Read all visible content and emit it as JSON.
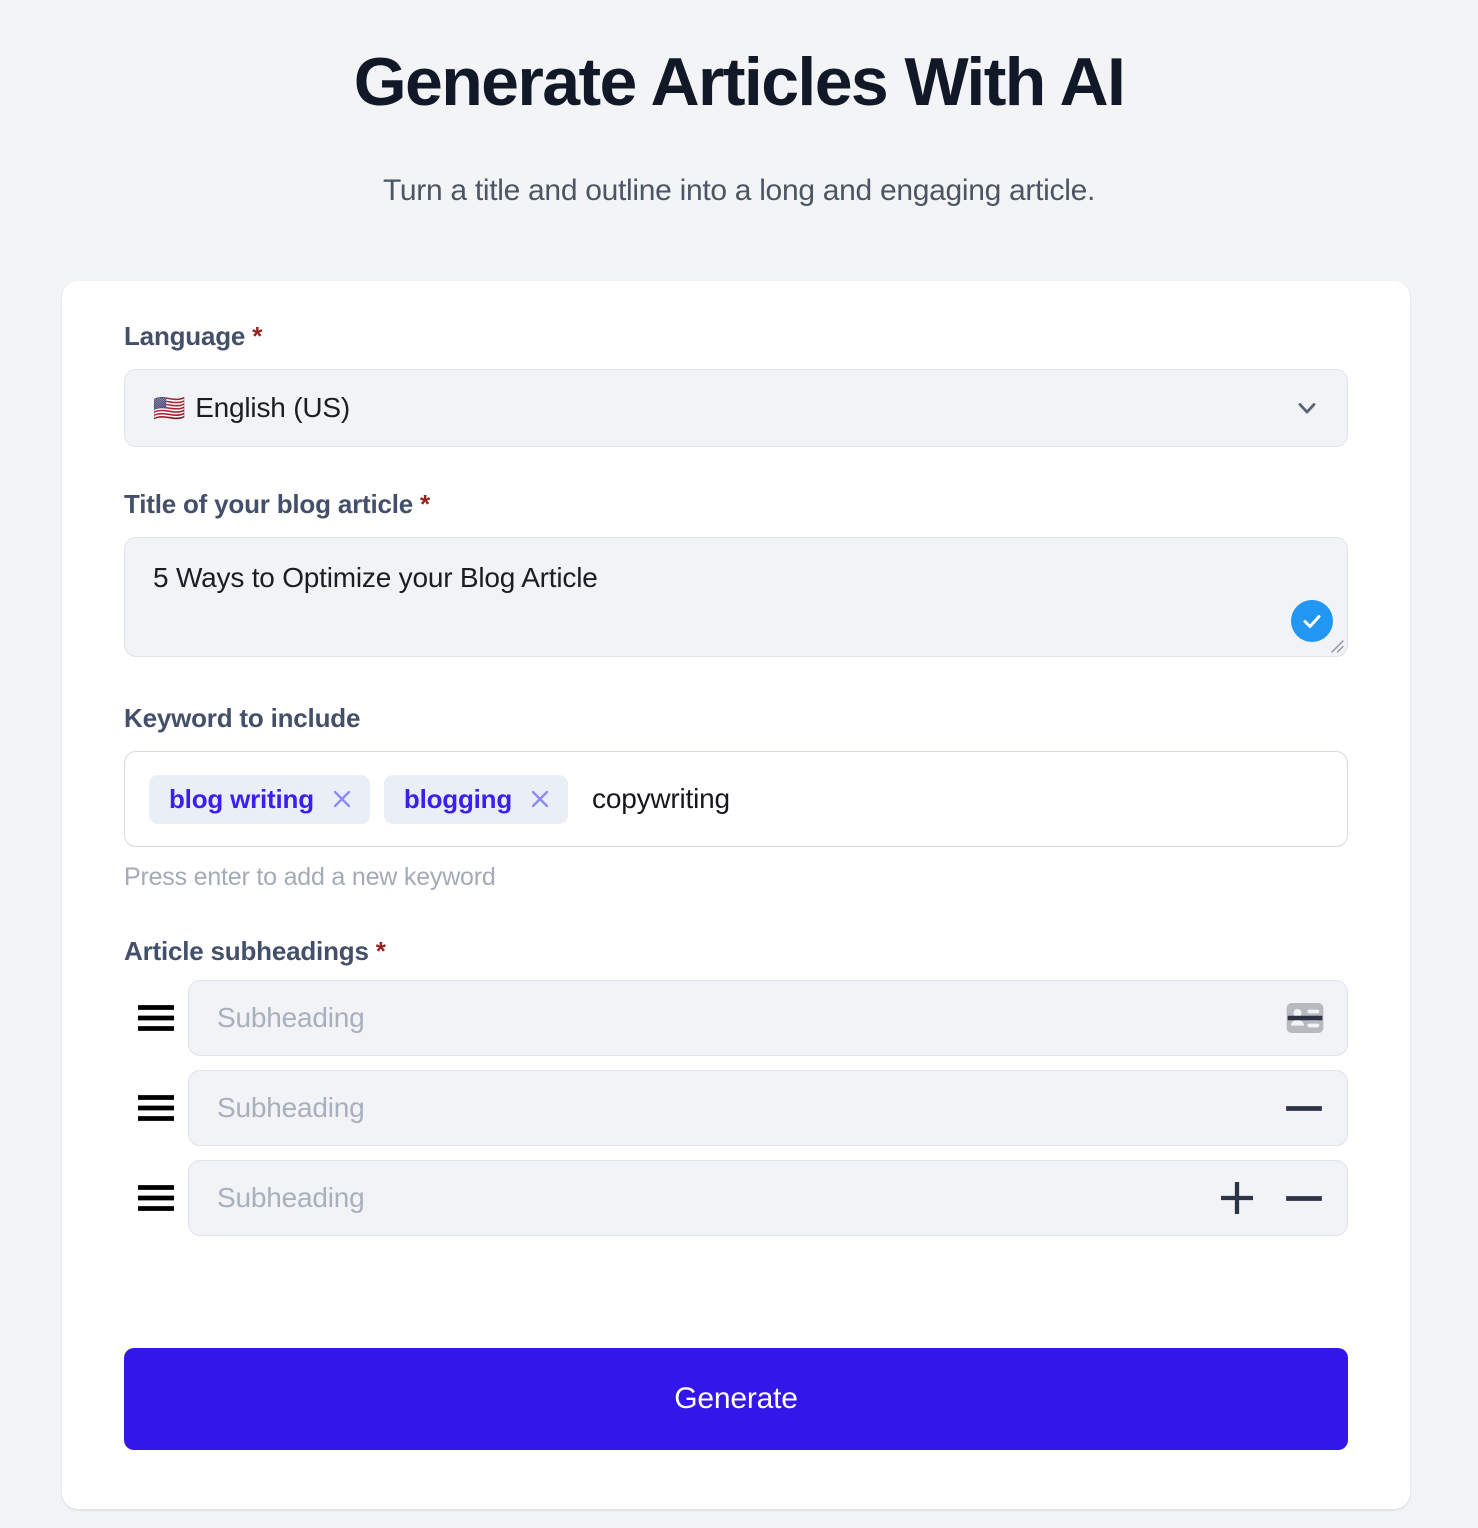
{
  "header": {
    "title": "Generate Articles With AI",
    "subtitle": "Turn a title and outline into a long and engaging article."
  },
  "form": {
    "language": {
      "label": "Language",
      "required_marker": "*",
      "flag": "🇺🇸",
      "value": "English (US)",
      "chevron_icon": "chevron-down-icon"
    },
    "title_field": {
      "label": "Title of your blog article",
      "required_marker": "*",
      "value": "5 Ways to Optimize your Blog Article",
      "valid_icon": "check-icon",
      "valid_color": "#2196f3"
    },
    "keywords": {
      "label": "Keyword to include",
      "chips": [
        {
          "label": "blog writing",
          "remove_icon": "close-icon"
        },
        {
          "label": "blogging",
          "remove_icon": "close-icon"
        }
      ],
      "input_value": "copywriting",
      "helper_text": "Press enter to add a new keyword",
      "chip_text_color": "#3b1ef0",
      "chip_bg_color": "#eaeef6"
    },
    "subheadings": {
      "label": "Article subheadings",
      "required_marker": "*",
      "rows": [
        {
          "placeholder": "Subheading",
          "drag_icon": "drag-handle-icon",
          "actions": [
            "card-placeholder-icon",
            "minus-icon"
          ]
        },
        {
          "placeholder": "Subheading",
          "drag_icon": "drag-handle-icon",
          "actions": [
            "minus-icon"
          ]
        },
        {
          "placeholder": "Subheading",
          "drag_icon": "drag-handle-icon",
          "actions": [
            "plus-icon",
            "minus-icon"
          ]
        }
      ]
    },
    "submit": {
      "label": "Generate",
      "color": "#3317e8"
    }
  }
}
